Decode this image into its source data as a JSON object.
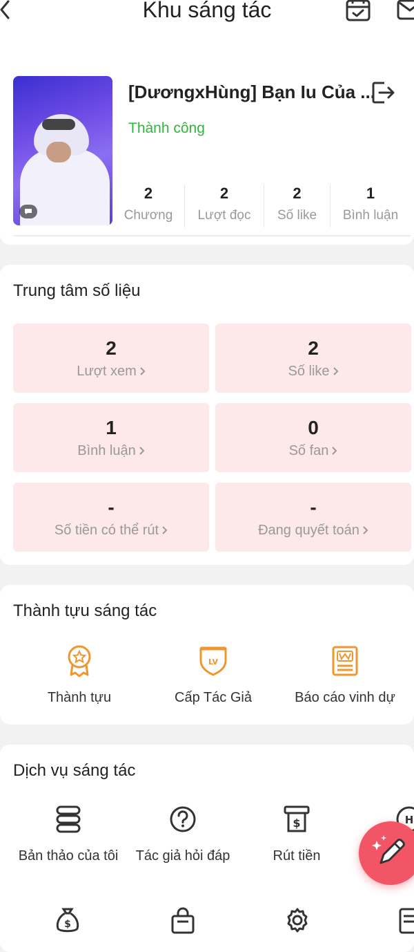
{
  "header": {
    "title": "Khu sáng tác"
  },
  "book": {
    "title": "[DươngxHùng] Bạn Iu Của ...",
    "status": "Thành công",
    "stats": [
      {
        "value": "2",
        "label": "Chương"
      },
      {
        "value": "2",
        "label": "Lượt đọc"
      },
      {
        "value": "2",
        "label": "Số like"
      },
      {
        "value": "1",
        "label": "Bình luận"
      }
    ]
  },
  "data_center": {
    "title": "Trung tâm số liệu",
    "tiles": [
      {
        "value": "2",
        "label": "Lượt xem"
      },
      {
        "value": "2",
        "label": "Số like"
      },
      {
        "value": "1",
        "label": "Bình luận"
      },
      {
        "value": "0",
        "label": "Số fan"
      },
      {
        "value": "-",
        "label": "Số tiền có thể rút"
      },
      {
        "value": "-",
        "label": "Đang quyết toán"
      }
    ]
  },
  "achievements": {
    "title": "Thành tựu sáng tác",
    "items": [
      {
        "label": "Thành tựu",
        "icon": "medal-icon"
      },
      {
        "label": "Cấp Tác Giả",
        "icon": "level-badge-icon"
      },
      {
        "label": "Báo cáo vinh dự",
        "icon": "honor-report-icon"
      }
    ]
  },
  "services": {
    "title": "Dịch vụ sáng tác",
    "items": [
      {
        "label": "Bản thảo của tôi",
        "icon": "drafts-icon"
      },
      {
        "label": "Tác giả hỏi đáp",
        "icon": "question-icon"
      },
      {
        "label": "Rút tiền",
        "icon": "withdraw-icon"
      }
    ]
  },
  "colors": {
    "accent_orange": "#f0962e",
    "success_green": "#2bb83a",
    "tile_pink": "#fde8ea",
    "fab_red": "#f25566"
  }
}
